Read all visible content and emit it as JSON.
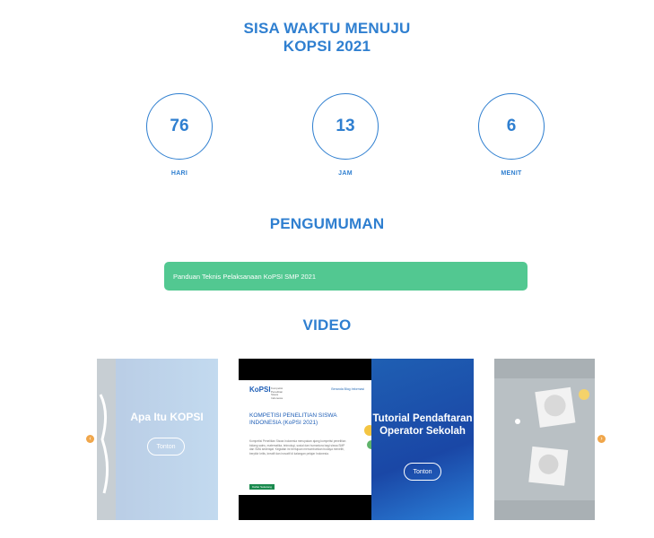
{
  "countdown": {
    "title_line1": "SISA WAKTU MENUJU",
    "title_line2": "KOPSI 2021",
    "items": [
      {
        "value": "76",
        "unit": "HARI"
      },
      {
        "value": "13",
        "unit": "JAM"
      },
      {
        "value": "6",
        "unit": "MENIT"
      }
    ],
    "accent_color": "#2f7fd0"
  },
  "announcements": {
    "title": "PENGUMUMAN",
    "items": [
      {
        "label": "Panduan Teknis Pelaksanaan KoPSI SMP 2021"
      }
    ],
    "bar_color": "#52c891"
  },
  "video": {
    "title": "VIDEO",
    "slides": [
      {
        "caption": "Apa Itu KOPSI",
        "button": "Tonton"
      },
      {
        "logo": "KoPSI",
        "logo_sub": "Kompetisi Penelitian Siswa Indonesia",
        "nav": "Beranda   Blog   Informasi",
        "heading": "KOMPETISI PENELITIAN SISWA INDONESIA (KoPSI 2021)",
        "paragraph": "Kompetisi Penelitian Siswa Indonesia merupakan ajang kompetisi penelitian bidang sains, matematika, teknologi, sosial dan humaniora bagi siswa SMP dan SMA sederajat. Kegiatan ini bertujuan menumbuhkan budaya meneliti, berpikir kritis, kreatif dan inovatif di kalangan pelajar Indonesia.",
        "button": "Daftar Sekarang"
      },
      {
        "caption": "Tutorial Pendaftaran Operator Sekolah",
        "button": "Tonton"
      },
      {}
    ],
    "prev_icon": "chevron-left-icon",
    "next_icon": "chevron-right-icon"
  }
}
